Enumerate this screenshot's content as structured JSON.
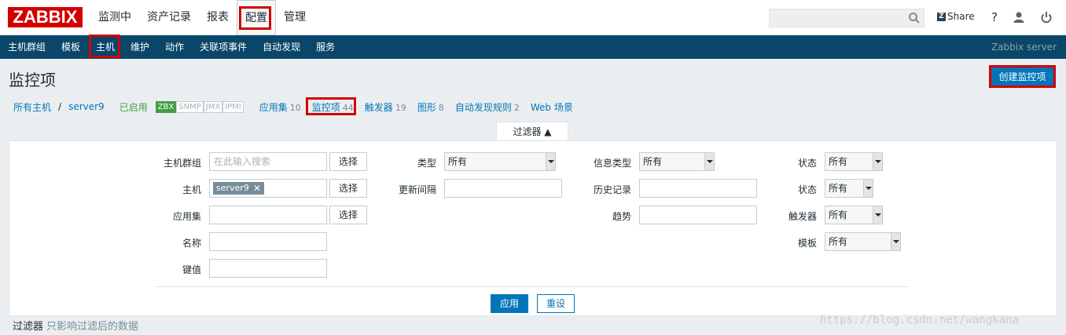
{
  "header": {
    "logo": "ZABBIX",
    "nav": [
      "监测中",
      "资产记录",
      "报表",
      "配置",
      "管理"
    ],
    "share_label": "Share",
    "help_label": "?"
  },
  "subnav": {
    "items": [
      "主机群组",
      "模板",
      "主机",
      "维护",
      "动作",
      "关联项事件",
      "自动发现",
      "服务"
    ],
    "server_name": "Zabbix server"
  },
  "page": {
    "title": "监控项",
    "create_button": "创建监控项"
  },
  "breadcrumb": {
    "all_hosts": "所有主机",
    "separator": "/",
    "host": "server9",
    "status": "已启用",
    "availability": [
      "ZBX",
      "SNMP",
      "JMX",
      "IPMI"
    ],
    "tabs": [
      {
        "label": "应用集",
        "count": "10"
      },
      {
        "label": "监控项",
        "count": "44"
      },
      {
        "label": "触发器",
        "count": "19"
      },
      {
        "label": "图形",
        "count": "8"
      },
      {
        "label": "自动发现规则",
        "count": "2"
      },
      {
        "label": "Web 场景",
        "count": ""
      }
    ]
  },
  "filter": {
    "tab_label": "过滤器 ▲",
    "host_group_label": "主机群组",
    "host_group_placeholder": "在此输入搜索",
    "select_label": "选择",
    "host_label": "主机",
    "host_chip": "server9",
    "application_label": "应用集",
    "name_label": "名称",
    "key_label": "键值",
    "type_label": "类型",
    "type_value": "所有",
    "interval_label": "更新间隔",
    "info_type_label": "信息类型",
    "info_type_value": "所有",
    "history_label": "历史记录",
    "trends_label": "趋势",
    "state_label": "状态",
    "state_value": "所有",
    "status_label": "状态",
    "status_value": "所有",
    "triggers_label": "触发器",
    "triggers_value": "所有",
    "template_label": "模板",
    "template_value": "所有",
    "apply_label": "应用",
    "reset_label": "重设"
  },
  "footer": {
    "filter_label": "过滤器",
    "filter_note": "只影响过滤后的数据",
    "watermark": "https://blog.csdn.net/wangkana"
  },
  "colors": {
    "accent": "#0275b8",
    "subnav_bg": "#0a466a",
    "highlight_box": "#d20000",
    "enabled_green": "#429e47"
  }
}
